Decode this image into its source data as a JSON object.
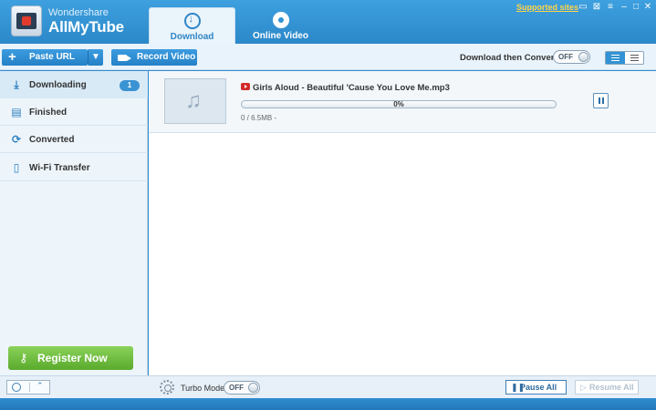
{
  "app": {
    "brand_top": "Wondershare",
    "brand_main": "AllMyTube"
  },
  "tabs": [
    {
      "label": "Download",
      "icon": "download-circle-icon",
      "active": true
    },
    {
      "label": "Online Video",
      "icon": "film-reel-icon",
      "active": false
    }
  ],
  "header": {
    "supported_sites": "Supported sites",
    "window_controls": [
      "chat-icon",
      "close-small-icon",
      "menu-icon",
      "minimize-icon",
      "maximize-icon",
      "close-icon"
    ]
  },
  "toolbar": {
    "paste_url": "Paste URL",
    "record_video": "Record Video",
    "download_then_convert": "Download then Convert",
    "convert_toggle": "OFF"
  },
  "sidebar": {
    "items": [
      {
        "label": "Downloading",
        "badge": "1",
        "icon": "download-icon",
        "active": true
      },
      {
        "label": "Finished",
        "icon": "finished-icon",
        "active": false
      },
      {
        "label": "Converted",
        "icon": "convert-icon",
        "active": false
      },
      {
        "label": "Wi-Fi Transfer",
        "icon": "phone-icon",
        "active": false
      }
    ],
    "register": "Register Now"
  },
  "task": {
    "filename": "Girls Aloud - Beautiful 'Cause You Love Me.mp3",
    "progress_text": "0%",
    "progress": 0,
    "size": "0 / 6.5MB -"
  },
  "footer": {
    "turbo_label": "Turbo Mode:",
    "turbo_toggle": "OFF",
    "pause_all": "Pause All",
    "resume_all": "Resume All"
  },
  "colors": {
    "accent": "#2f8ccf",
    "register_green": "#6cbb3c",
    "supported_link": "#ffd54a"
  }
}
